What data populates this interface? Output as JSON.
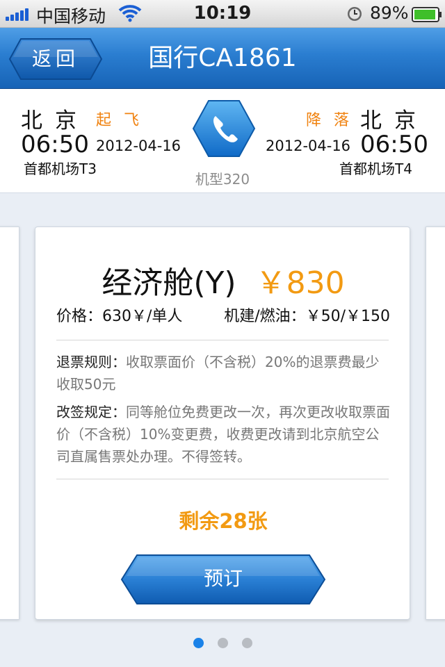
{
  "status_bar": {
    "carrier": "中国移动",
    "time": "10:19",
    "battery": "89%",
    "icons": [
      "signal-icon",
      "wifi-icon",
      "alarm-icon",
      "battery-icon"
    ]
  },
  "nav": {
    "back_label": "返回",
    "title": "国行CA1861"
  },
  "flight": {
    "departure": {
      "city": "北京",
      "tag": "起飞",
      "time": "06:50",
      "date": "2012-04-16",
      "airport": "首都机场T3"
    },
    "arrival": {
      "city": "北京",
      "tag": "降落",
      "time": "06:50",
      "date": "2012-04-16",
      "airport": "首都机场T4"
    },
    "aircraft": "机型320",
    "phone_icon": "phone-icon"
  },
  "fare": {
    "cabin": "经济舱(Y)",
    "price": "￥830",
    "base_price": "价格：630￥/单人",
    "taxes": "机建/燃油：￥50/￥150",
    "refund_label": "退票规则：",
    "refund_text": "收取票面价（不含税）20%的退票费最少收取50元",
    "change_label": "改签规定：",
    "change_text": "同等舱位免费更改一次，再次更改收取票面价（不含税）10%变更费，收费更改请到北京航空公司直属售票处办理。不得签转。",
    "remaining": "剩余28张",
    "book_label": "预订"
  },
  "pager": {
    "count": 3,
    "active": 1
  },
  "colors": {
    "accent": "#f29a12",
    "nav_blue": "#1f6fc4",
    "dot_active": "#1a82e8"
  }
}
